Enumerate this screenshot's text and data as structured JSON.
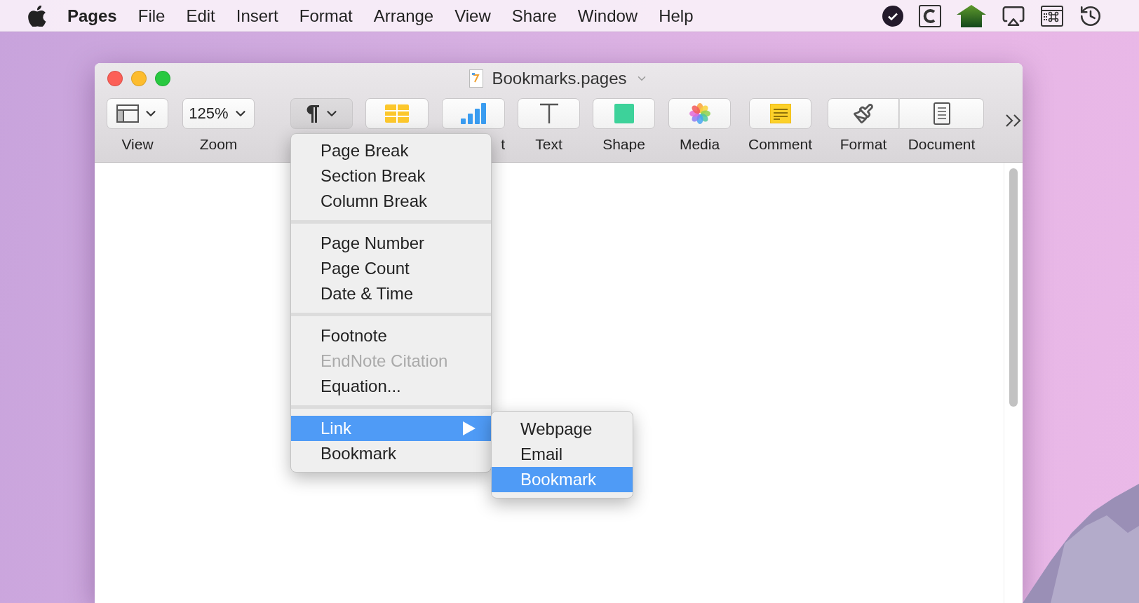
{
  "menu_bar": {
    "app": "Pages",
    "menus": [
      "File",
      "Edit",
      "Insert",
      "Format",
      "Arrange",
      "View",
      "Share",
      "Window",
      "Help"
    ]
  },
  "window": {
    "title": "Bookmarks.pages"
  },
  "toolbar": [
    {
      "kind": "view",
      "label": "View",
      "pressed": false
    },
    {
      "kind": "zoom",
      "value": "125%",
      "label": "Zoom",
      "pressed": false
    },
    {
      "kind": "insert",
      "pressed": true
    },
    {
      "kind": "table",
      "pressed": false
    },
    {
      "kind": "chart",
      "label": "t",
      "pressed": false
    },
    {
      "kind": "text",
      "label": "Text",
      "pressed": false
    },
    {
      "kind": "shape",
      "label": "Shape",
      "pressed": false
    },
    {
      "kind": "media",
      "label": "Media",
      "pressed": false
    },
    {
      "kind": "comment",
      "label": "Comment",
      "pressed": false
    },
    {
      "kind": "format",
      "label": "Format",
      "pressed": false
    },
    {
      "kind": "document",
      "label": "Document",
      "pressed": false
    }
  ],
  "insert_menu": {
    "sections": [
      {
        "items": [
          {
            "label": "Page Break",
            "kind": "command",
            "disabled": false,
            "selected": false
          },
          {
            "label": "Section Break",
            "kind": "command",
            "disabled": false,
            "selected": false
          },
          {
            "label": "Column Break",
            "kind": "command",
            "disabled": false,
            "selected": false
          }
        ]
      },
      {
        "items": [
          {
            "label": "Page Number",
            "kind": "command",
            "disabled": false,
            "selected": false
          },
          {
            "label": "Page Count",
            "kind": "command",
            "disabled": false,
            "selected": false
          },
          {
            "label": "Date & Time",
            "kind": "command",
            "disabled": false,
            "selected": false
          }
        ]
      },
      {
        "items": [
          {
            "label": "Footnote",
            "kind": "command",
            "disabled": false,
            "selected": false
          },
          {
            "label": "EndNote Citation",
            "kind": "command",
            "disabled": true,
            "selected": false
          },
          {
            "label": "Equation...",
            "kind": "command",
            "disabled": false,
            "selected": false
          }
        ]
      },
      {
        "items": [
          {
            "label": "Link",
            "kind": "submenu",
            "disabled": false,
            "selected": true
          },
          {
            "label": "Bookmark",
            "kind": "command",
            "disabled": false,
            "selected": false
          }
        ]
      }
    ]
  },
  "link_submenu": {
    "items": [
      {
        "label": "Webpage",
        "selected": false
      },
      {
        "label": "Email",
        "selected": false
      },
      {
        "label": "Bookmark",
        "selected": true
      }
    ]
  }
}
